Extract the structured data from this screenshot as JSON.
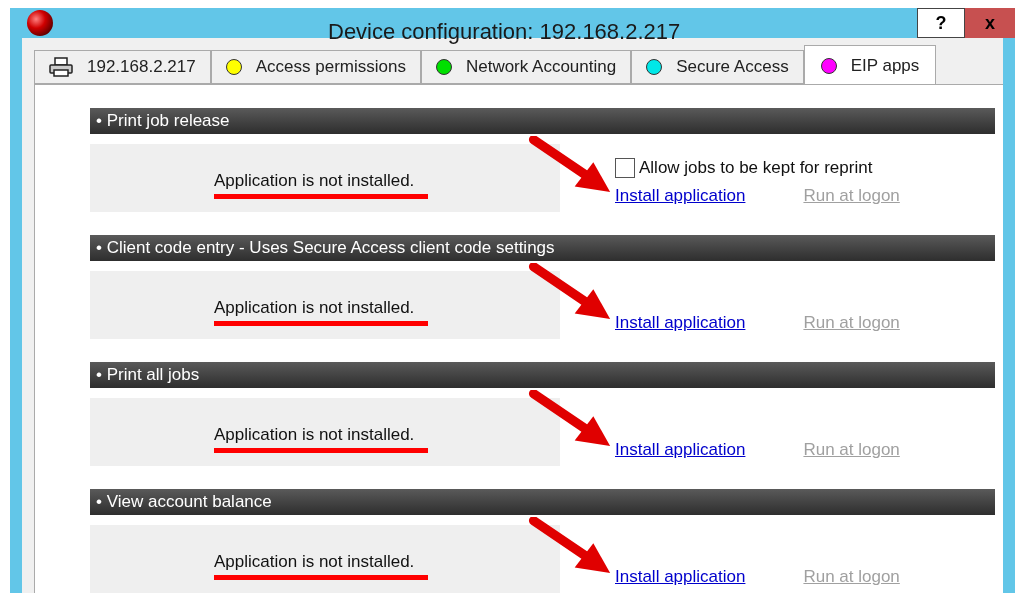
{
  "window": {
    "title": "Device configuration: 192.168.2.217",
    "buttons": [
      "?",
      "x"
    ]
  },
  "tabs": [
    {
      "label": "192.168.2.217",
      "kind": "printer",
      "selected": false
    },
    {
      "label": "Access permissions",
      "kind": "dot",
      "color": "#ffff00",
      "selected": false
    },
    {
      "label": "Network Accounting",
      "kind": "dot",
      "color": "#00e000",
      "selected": false
    },
    {
      "label": "Secure Access",
      "kind": "dot",
      "color": "#00e8e8",
      "selected": false
    },
    {
      "label": "EIP apps",
      "kind": "dot",
      "color": "#ff00ff",
      "selected": true
    }
  ],
  "sections": [
    {
      "title": "• Print job release",
      "status": "Application is not installed.",
      "option": {
        "label": "Allow jobs to be kept for reprint",
        "checked": false
      },
      "install_link": {
        "label": "Install application",
        "disabled": false
      },
      "logon_link": {
        "label": "Run at logon",
        "disabled": true
      }
    },
    {
      "title": "• Client code entry - Uses Secure Access client code settings",
      "status": "Application is not installed.",
      "install_link": {
        "label": "Install application",
        "disabled": false
      },
      "logon_link": {
        "label": "Run at logon",
        "disabled": true
      }
    },
    {
      "title": "• Print all jobs",
      "status": "Application is not installed.",
      "install_link": {
        "label": "Install application",
        "disabled": false
      },
      "logon_link": {
        "label": "Run at logon",
        "disabled": true
      }
    },
    {
      "title": "• View account balance",
      "status": "Application is not installed.",
      "install_link": {
        "label": "Install application",
        "disabled": false
      },
      "logon_link": {
        "label": "Run at logon",
        "disabled": true
      }
    }
  ]
}
